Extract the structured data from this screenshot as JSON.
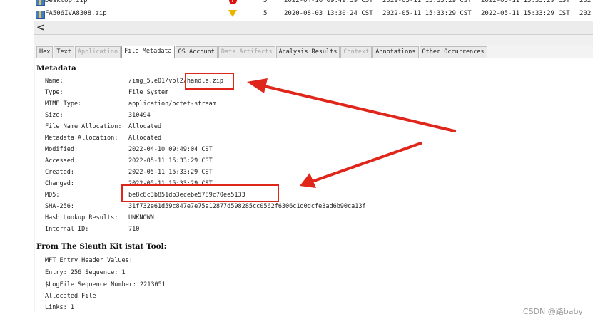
{
  "files": [
    {
      "name": "Desktop.zip",
      "flag": "!",
      "num": "5",
      "d1": "2022-04-10 09:49:39 CST",
      "d2": "2022-05-11 15:33:29 CST",
      "d3": "2022-05-11 15:33:29 CST",
      "d4": "202"
    },
    {
      "name": "FA506IVA8308.zip",
      "flag": "▽",
      "num": "5",
      "d1": "2020-08-03 13:30:24 CST",
      "d2": "2022-05-11 15:33:29 CST",
      "d3": "2022-05-11 15:33:29 CST",
      "d4": "202"
    }
  ],
  "scroll_left_glyph": "<",
  "tabs": [
    {
      "label": "Hex",
      "state": "normal"
    },
    {
      "label": "Text",
      "state": "normal"
    },
    {
      "label": "Application",
      "state": "disabled"
    },
    {
      "label": "File Metadata",
      "state": "active"
    },
    {
      "label": "OS Account",
      "state": "normal"
    },
    {
      "label": "Data Artifacts",
      "state": "disabled"
    },
    {
      "label": "Analysis Results",
      "state": "normal"
    },
    {
      "label": "Context",
      "state": "disabled"
    },
    {
      "label": "Annotations",
      "state": "normal"
    },
    {
      "label": "Other Occurrences",
      "state": "normal"
    }
  ],
  "metadata": {
    "heading": "Metadata",
    "rows": [
      {
        "label": "Name:",
        "value": "/img_5.e01/vol2/handle.zip"
      },
      {
        "label": "Type:",
        "value": "File System"
      },
      {
        "label": "MIME Type:",
        "value": "application/octet-stream"
      },
      {
        "label": "Size:",
        "value": "310494"
      },
      {
        "label": "File Name Allocation:",
        "value": "Allocated"
      },
      {
        "label": "Metadata Allocation:",
        "value": "Allocated"
      },
      {
        "label": "Modified:",
        "value": "2022-04-10 09:49:04 CST"
      },
      {
        "label": "Accessed:",
        "value": "2022-05-11 15:33:29 CST"
      },
      {
        "label": "Created:",
        "value": "2022-05-11 15:33:29 CST"
      },
      {
        "label": "Changed:",
        "value": "2022-05-11 15:33:29 CST"
      },
      {
        "label": "MD5:",
        "value": "be8c8c3b851db3ecebe5789c70ee5133"
      },
      {
        "label": "SHA-256:",
        "value": "31f732e61d59c847e7e75e12877d598285cc0562f6306c1d0dcfe3ad6b90ca13f"
      },
      {
        "label": "Hash Lookup Results:",
        "value": "UNKNOWN"
      },
      {
        "label": "Internal ID:",
        "value": "710"
      }
    ]
  },
  "istat": {
    "heading": "From The Sleuth Kit istat Tool:",
    "lines": [
      "MFT Entry Header Values:",
      "Entry: 256 Sequence: 1",
      "$LogFile Sequence Number: 2213051",
      "Allocated File",
      "Links: 1"
    ]
  },
  "annotation_color": "#e0261b",
  "watermark": "CSDN @路baby"
}
